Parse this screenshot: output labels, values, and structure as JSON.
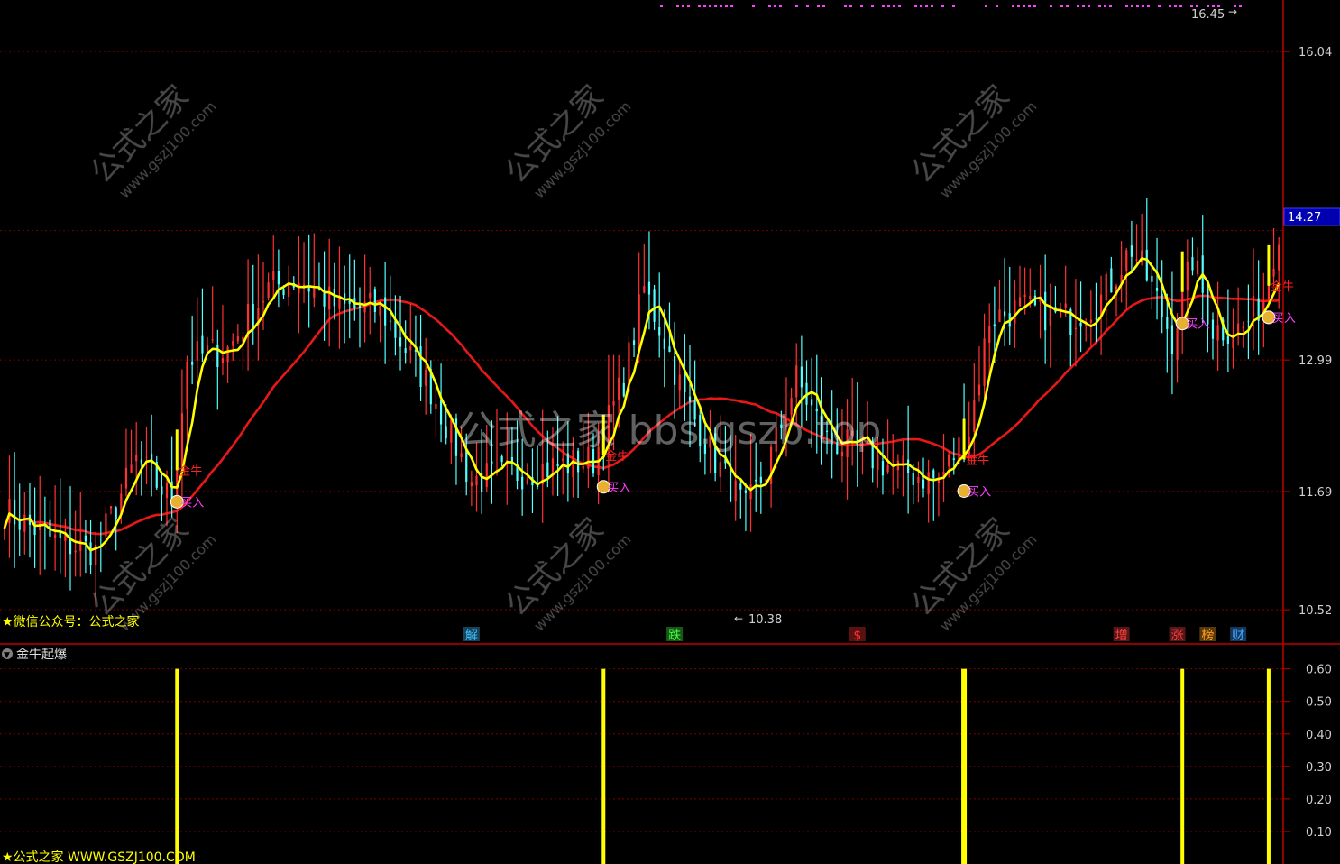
{
  "colors": {
    "up": "#ff3232",
    "down": "#54ffff",
    "ma_long": "#e81818",
    "ma_short": "#ffff00",
    "grid": "#7a0000",
    "axis": "#c00000",
    "axis_text": "#d0d0d0",
    "marker": "#ff40ff",
    "signal": "#ffff00",
    "buy_text": "#ff40ff",
    "jinniu_text": "#ff2020",
    "current_price_bg": "#0000b0"
  },
  "main_panel": {
    "watermark_center": "公式之家 bbs.gszb.top",
    "watermark_tile_title": "公式之家",
    "watermark_tile_url": "www.gszj100.com",
    "bottom_left_caption": "★微信公众号：公式之家",
    "current_price_tag": "14.27",
    "high_annotation": "16.45",
    "low_annotation": "10.38"
  },
  "sub_panel": {
    "indicator_name": "金牛起爆",
    "bottom_caption": "★公式之家 WWW.GSZJ100.COM"
  },
  "event_tags": [
    {
      "text": "解",
      "color": "#40c0ff",
      "bar": 92
    },
    {
      "text": "跌",
      "color": "#40ff40",
      "bar": 132
    },
    {
      "text": "$",
      "color": "#ff3030",
      "bar": 168
    },
    {
      "text": "增",
      "color": "#ff4040",
      "bar": 220
    },
    {
      "text": "涨",
      "color": "#ff4040",
      "bar": 231
    },
    {
      "text": "榜",
      "color": "#ffa020",
      "bar": 237
    },
    {
      "text": "财",
      "color": "#40a0ff",
      "bar": 243
    }
  ],
  "signal_labels": {
    "jinniu": "金牛",
    "buy": "买入"
  },
  "chart_data": [
    {
      "type": "candlestick",
      "title": "",
      "y_ticks": [
        10.52,
        11.69,
        12.99,
        14.27,
        16.04
      ],
      "ylim": [
        10.2,
        16.55
      ],
      "bars": 252,
      "grid": true,
      "series": [
        {
          "name": "",
          "kind": "line",
          "color": "#ffff00",
          "period": 5
        },
        {
          "name": "",
          "kind": "line",
          "color": "#e81818",
          "period": 30
        }
      ],
      "signals_buy_bars": [
        34,
        118,
        189,
        232,
        249
      ],
      "signals_jinniu_bars": [
        34,
        118,
        189,
        249
      ]
    },
    {
      "type": "bar",
      "title": "金牛起爆",
      "y_ticks": [
        0.1,
        0.2,
        0.3,
        0.4,
        0.5,
        0.6
      ],
      "ylim": [
        0,
        0.66
      ],
      "signal_bars": [
        34,
        118,
        189,
        232,
        249
      ],
      "signal_value": 0.6
    }
  ]
}
